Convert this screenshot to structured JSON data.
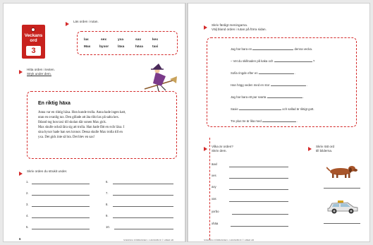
{
  "left_page": {
    "tag": {
      "title_line1": "Veckans",
      "title_line2": "ord",
      "number": "3"
    },
    "task1": {
      "instruction": "Läs orden i rutan."
    },
    "word_box": {
      "row1": [
        "lax",
        "sex",
        "yxa",
        "sax",
        "kex"
      ],
      "row2": [
        "Max",
        "byxor",
        "läxa",
        "häxa",
        "taxi"
      ]
    },
    "task2": {
      "instruction_line1": "Hitta orden i texten.",
      "instruction_line2": "Stryk under dem."
    },
    "story": {
      "title": "En riktig häxa",
      "lines": [
        "Anna var en riktig häxa. Hon kunde trolla. Anna hade ingen katt,",
        "utan en ovanlig tax. Den gillade att äta rökt lax på salta kex.",
        "Ibland tog hon taxi till skolan där sonen Max gick.",
        "Max skulle också lära sig att trolla. Han hade fått en svår läxa. I",
        "sina byxor hade han sex kronor. Dessa skulle Max trolla till en",
        "yxa. Det gick inte så bra. Det blev en sax!"
      ]
    },
    "task3": {
      "instruction": "Skriv orden du strukit under."
    },
    "numbers_left": [
      "1.",
      "2.",
      "3.",
      "4.",
      "5."
    ],
    "numbers_right": [
      "6.",
      "7.",
      "8.",
      "9.",
      "10."
    ],
    "page_number": "6",
    "footer": "SVENSKA FÖRBANDEN • GRUNDBOK © LIBER AB"
  },
  "right_page": {
    "task1": {
      "instruction_line1": "Skriv färdigt meningarna.",
      "instruction_line2": "Välj bland orden i rutan på förra sidan."
    },
    "sentences": [
      {
        "before": "Jag har bara en",
        "after": "denna vecka."
      },
      {
        "before": "– Vet du skillnaden på kaka och",
        "after": "?"
      },
      {
        "before": "Sofia ringde efter en",
        "after": "."
      },
      {
        "before": "Han högg veden med en stor",
        "after": "."
      },
      {
        "before": "Jag har bara ett par svarta",
        "after": "."
      },
      {
        "before": "Saxie",
        "after": "och sallad är riktigt gott."
      },
      {
        "before": "Tre plus tre är lika med",
        "after": "."
      }
    ],
    "task2": {
      "instruction_line1": "Vilka är orden?",
      "instruction_line2": "Skriv dem."
    },
    "scrambled": [
      "äaxl",
      "xes",
      "axy",
      "xas",
      "yxrbo",
      "xhäa"
    ],
    "task3": {
      "instruction_line1": "Skriv rätt ord",
      "instruction_line2": "till bilderna."
    },
    "footer": "SVENSKA FÖRBANDEN • GRUNDBOK © LIBER AB"
  },
  "colors": {
    "accent": "#d42a2a",
    "tag": "#c8221e"
  }
}
